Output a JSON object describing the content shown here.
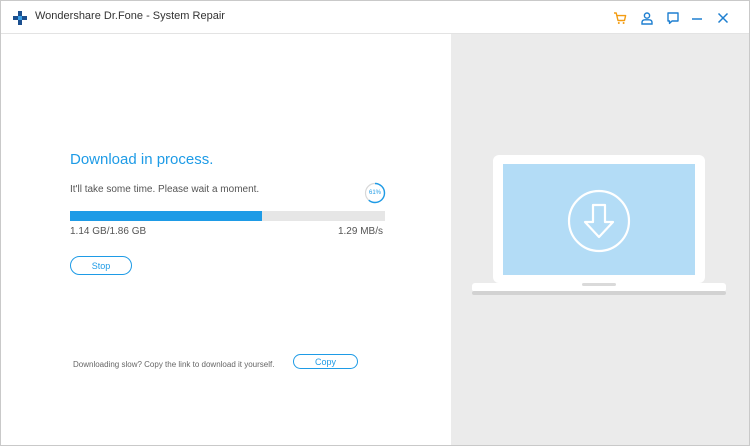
{
  "window": {
    "title": "Wondershare Dr.Fone - System Repair"
  },
  "titlebar": {
    "buttons": [
      {
        "name": "cart",
        "icon": "cart-icon",
        "color": "#f39c12"
      },
      {
        "name": "account",
        "icon": "user-icon",
        "color": "#1e7fd0"
      },
      {
        "name": "feedback",
        "icon": "chat-icon",
        "color": "#1e7fd0"
      },
      {
        "name": "minimize",
        "icon": "minimize-icon",
        "color": "#1e7fd0"
      },
      {
        "name": "close",
        "icon": "close-icon",
        "color": "#1e7fd0"
      }
    ]
  },
  "download": {
    "headline": "Download in process.",
    "subtext": "It'll take some time. Please wait a moment.",
    "percent_label": "61%",
    "progress_fraction": 0.61,
    "size_text": "1.14 GB/1.86 GB",
    "speed_text": "1.29 MB/s",
    "stop_label": "Stop",
    "slow_text": "Downloading slow? Copy the link to download it yourself.",
    "copy_label": "Copy"
  },
  "colors": {
    "accent": "#1e9be6",
    "screen": "#b3dcf6",
    "right_pane_bg": "#ebebeb"
  },
  "illustration": {
    "icon": "download-arrow-icon"
  }
}
